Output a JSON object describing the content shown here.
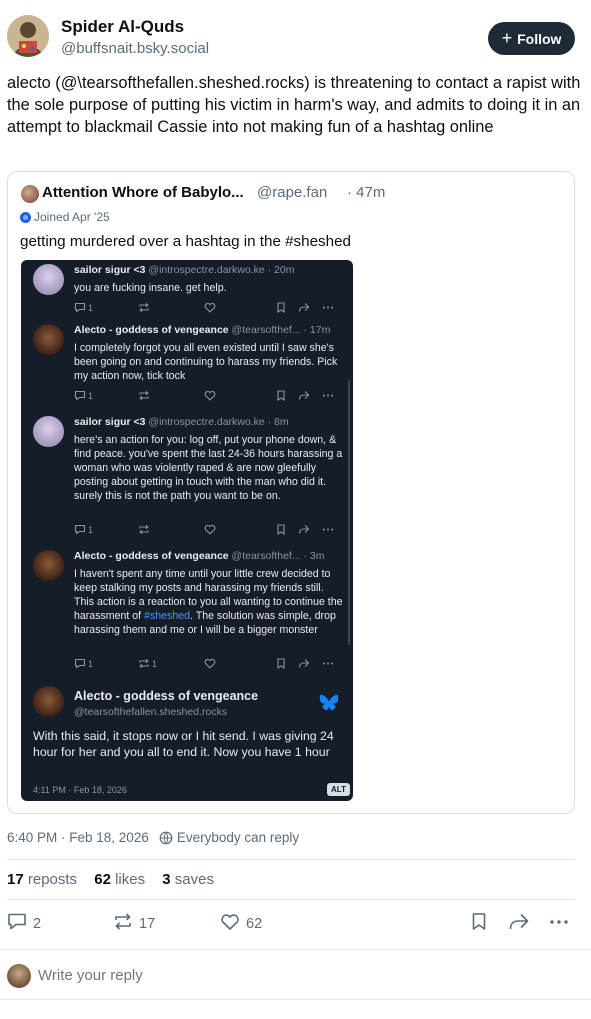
{
  "author": {
    "display_name": "Spider Al-Quds",
    "handle": "@buffsnait.bsky.social",
    "follow_label": "Follow"
  },
  "post": {
    "text": "alecto (@\\tearsofthefallen.sheshed.rocks) is threatening to contact a rapist with the sole purpose of putting his victim in harm's way, and admits to doing it in an attempt to blackmail Cassie into not making fun of a hashtag online"
  },
  "quote": {
    "name": "Attention Whore of Babylo...",
    "handle": "@rape.fan",
    "time": "· 47m",
    "joined": "Joined Apr '25",
    "text": "getting murdered over a hashtag in the #sheshed",
    "screenshot": {
      "posts": [
        {
          "name": "sailor sigur <3",
          "meta": "@introspectre.darkwo.ke · 20m",
          "body": "you are fucking insane. get help.",
          "replies": "1",
          "reposts": ""
        },
        {
          "name": "Alecto - goddess of vengeance",
          "meta": "@tearsofthef... · 17m",
          "body": "I completely forgot you all even existed until I saw she's been going on and continuing to harass my friends. Pick my action now, tick tock",
          "replies": "1",
          "reposts": ""
        },
        {
          "name": "sailor sigur <3",
          "meta": "@introspectre.darkwo.ke · 8m",
          "body": "here's an action for you: log off, put your phone down, & find peace. you've spent the last 24-36 hours harassing a woman who was violently raped & are now gleefully posting about getting in touch with the man who did it. surely this is not the path you want to be on.",
          "replies": "1",
          "reposts": ""
        },
        {
          "name": "Alecto - goddess of vengeance",
          "meta": "@tearsofthef... · 3m",
          "body_before": "I haven't spent any time until your little crew decided to keep stalking my posts and harassing my friends still. This action is a reaction to you all wanting to continue the harassment of ",
          "body_tag": "#sheshed",
          "body_after": ". The solution was simple, drop harassing them and me or I will be a bigger monster",
          "replies": "1",
          "reposts": "1"
        }
      ],
      "main": {
        "name": "Alecto - goddess of vengeance",
        "handle": "@tearsofthefallen.sheshed.rocks",
        "body": "With this said, it stops now or I hit send. I was giving 24 hour for her and you all to end it. Now you have 1 hour",
        "time": "4:11 PM · Feb 18, 2026",
        "alt_label": "ALT"
      }
    }
  },
  "meta": {
    "timestamp": "6:40 PM · Feb 18, 2026",
    "reply_setting": "Everybody can reply"
  },
  "stats": {
    "reposts_count": "17",
    "reposts_label": "reposts",
    "likes_count": "62",
    "likes_label": "likes",
    "saves_count": "3",
    "saves_label": "saves"
  },
  "actions": {
    "replies": "2",
    "reposts": "17",
    "likes": "62"
  },
  "reply_box": {
    "placeholder": "Write your reply"
  },
  "colors": {
    "follow_bg": "#1f2a37",
    "link_blue": "#4f93ff",
    "butterfly": "#1185fe",
    "screenshot_bg": "#151d28"
  }
}
